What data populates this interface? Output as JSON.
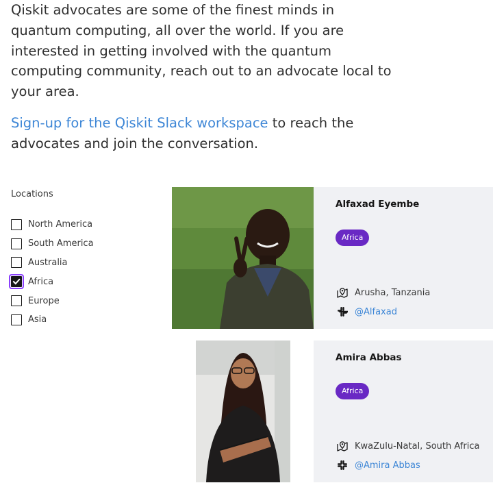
{
  "intro": {
    "paragraph1": "Qiskit advocates are some of the finest minds in quantum computing, all over the world. If you are interested in getting involved with the quantum computing community, reach out to an advocate local to your area.",
    "slack_link": "Sign-up for the Qiskit Slack workspace",
    "paragraph2_rest": " to reach the advocates and join the conversation."
  },
  "filters": {
    "label": "Locations",
    "options": [
      {
        "label": "North America",
        "checked": false
      },
      {
        "label": "South America",
        "checked": false
      },
      {
        "label": "Australia",
        "checked": false
      },
      {
        "label": "Africa",
        "checked": true
      },
      {
        "label": "Europe",
        "checked": false
      },
      {
        "label": "Asia",
        "checked": false
      }
    ]
  },
  "advocates": [
    {
      "name": "Alfaxad Eyembe",
      "region": "Africa",
      "location": "Arusha, Tanzania",
      "slack": "@Alfaxad"
    },
    {
      "name": "Amira Abbas",
      "region": "Africa",
      "location": "KwaZulu-Natal, South Africa",
      "slack": "@Amira Abbas"
    }
  ],
  "colors": {
    "link": "#3d86d6",
    "tag_bg": "#6929c4",
    "focus": "#8a3ffc",
    "card_bg": "#f0f1f4"
  },
  "icons": {
    "location": "location-pin-icon",
    "slack": "slack-icon",
    "check": "checkmark-icon"
  }
}
